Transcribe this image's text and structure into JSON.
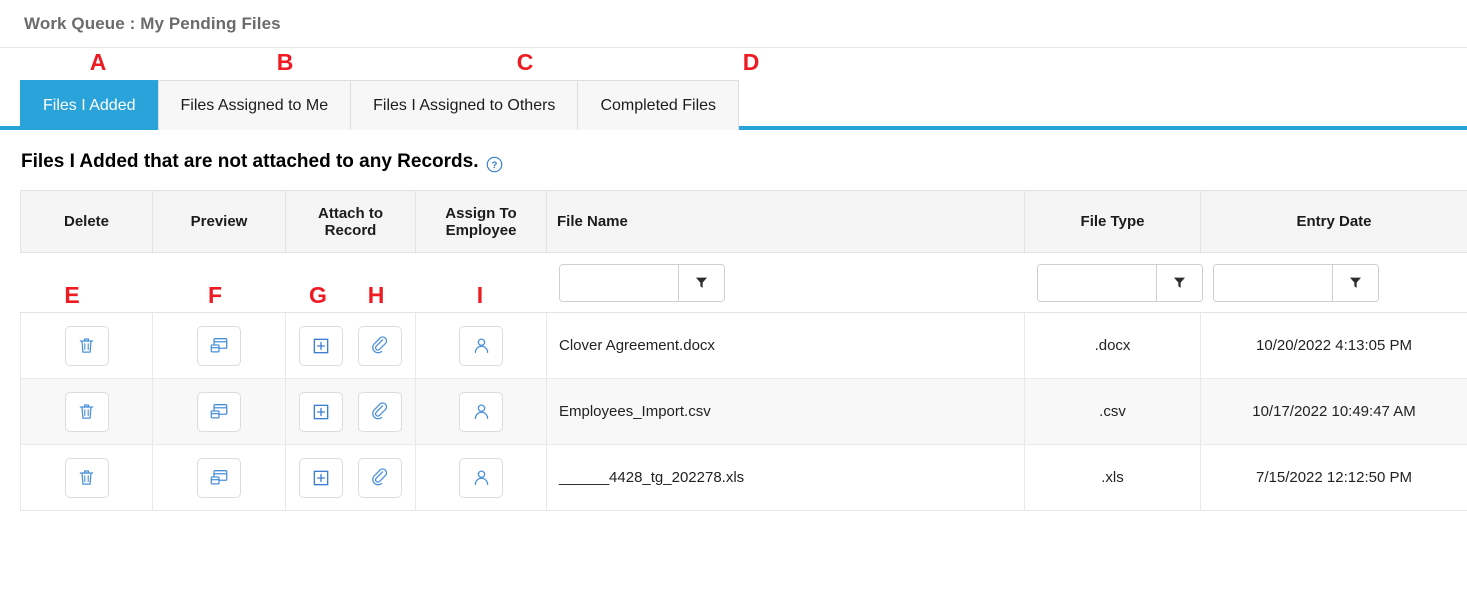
{
  "header": {
    "title": "Work Queue : My Pending Files"
  },
  "tabs": [
    {
      "label": "Files I Added",
      "active": true,
      "annotation": "A"
    },
    {
      "label": "Files Assigned to Me",
      "active": false,
      "annotation": "B"
    },
    {
      "label": "Files I Assigned to Others",
      "active": false,
      "annotation": "C"
    },
    {
      "label": "Completed Files",
      "active": false,
      "annotation": "D"
    }
  ],
  "section": {
    "heading": "Files I Added that are not attached to any Records.",
    "help_icon": "help-circle-icon"
  },
  "grid": {
    "columns": [
      {
        "key": "delete",
        "label": "Delete"
      },
      {
        "key": "preview",
        "label": "Preview"
      },
      {
        "key": "attach",
        "label": "Attach to Record"
      },
      {
        "key": "assign",
        "label": "Assign To Employee"
      },
      {
        "key": "filename",
        "label": "File Name"
      },
      {
        "key": "filetype",
        "label": "File Type"
      },
      {
        "key": "entrydate",
        "label": "Entry Date"
      }
    ],
    "filters": {
      "filename": {
        "value": "",
        "placeholder": "",
        "button_icon": "funnel-icon"
      },
      "filetype": {
        "value": "",
        "placeholder": "",
        "button_icon": "funnel-icon"
      },
      "entrydate": {
        "value": "",
        "placeholder": "",
        "button_icon": "funnel-icon"
      }
    },
    "row_action_icons": {
      "delete": "trash-icon",
      "preview": "preview-window-icon",
      "attach_record": "plus-square-icon",
      "attach_file": "paperclip-icon",
      "assign": "person-icon"
    },
    "rows": [
      {
        "filename": "Clover Agreement.docx",
        "filetype": ".docx",
        "entrydate": "10/20/2022 4:13:05 PM"
      },
      {
        "filename": "Employees_Import.csv",
        "filetype": ".csv",
        "entrydate": "10/17/2022 10:49:47 AM"
      },
      {
        "filename": "______4428_tg_202278.xls",
        "filetype": ".xls",
        "entrydate": "7/15/2022 12:12:50 PM"
      }
    ]
  },
  "annotations": [
    {
      "letter": "A",
      "target": "tab-files-i-added"
    },
    {
      "letter": "B",
      "target": "tab-files-assigned-to-me"
    },
    {
      "letter": "C",
      "target": "tab-files-i-assigned-to-others"
    },
    {
      "letter": "D",
      "target": "tab-completed-files"
    },
    {
      "letter": "E",
      "target": "delete-button"
    },
    {
      "letter": "F",
      "target": "preview-button"
    },
    {
      "letter": "G",
      "target": "attach-to-record-button"
    },
    {
      "letter": "H",
      "target": "attach-file-button"
    },
    {
      "letter": "I",
      "target": "assign-to-employee-button"
    }
  ],
  "colors": {
    "accent_blue": "#29a3d9",
    "annotation_red": "#ee1b22",
    "icon_blue": "#4a90d9",
    "title_gray": "#6b6b6b"
  }
}
